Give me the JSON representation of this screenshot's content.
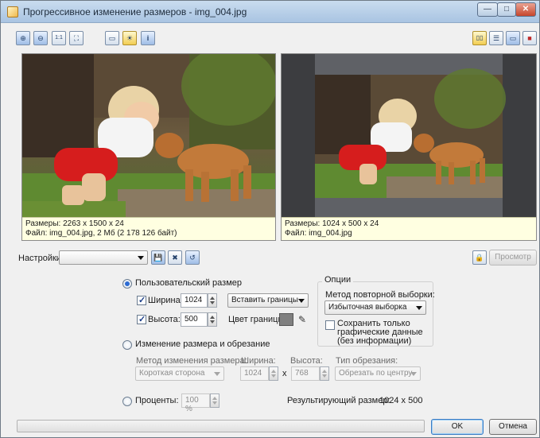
{
  "window": {
    "title": "Прогрессивное изменение размеров - img_004.jpg",
    "min_symbol": "—",
    "max_symbol": "□",
    "close_symbol": "✕"
  },
  "toolbar_left": [
    {
      "icon": "zoom-in-icon",
      "glyph": "⊕"
    },
    {
      "icon": "zoom-out-icon",
      "glyph": "⊖"
    },
    {
      "icon": "actual-size-icon",
      "glyph": "1:1"
    },
    {
      "icon": "fit-window-icon",
      "glyph": "⛶"
    },
    {
      "icon": "image-info-icon",
      "glyph": "▭"
    },
    {
      "icon": "sun-icon",
      "glyph": "☀"
    },
    {
      "icon": "info-icon",
      "glyph": "i"
    }
  ],
  "toolbar_right": [
    {
      "icon": "layout-side-by-side-icon",
      "glyph": "▯▯"
    },
    {
      "icon": "layout-stacked-icon",
      "glyph": "☰"
    },
    {
      "icon": "layout-single-icon",
      "glyph": "▭"
    },
    {
      "icon": "layout-full-icon",
      "glyph": "■"
    }
  ],
  "preview_original": {
    "size_line": "Размеры: 2263 x 1500 x 24",
    "file_line": "Файл: img_004.jpg, 2 Мб (2 178 126 байт)"
  },
  "preview_result": {
    "size_line": "Размеры: 1024 x 500 x 24",
    "file_line": "Файл: img_004.jpg"
  },
  "settings": {
    "label": "Настройки:",
    "value": "",
    "preview_button": "Просмотр"
  },
  "custom_size": {
    "label": "Пользовательский размер",
    "selected": true,
    "width_label": "Ширина:",
    "width_value": "1024",
    "width_checked": true,
    "height_label": "Высота:",
    "height_value": "500",
    "height_checked": true,
    "border_mode": "Вставить границы",
    "border_color_label": "Цвет границы:",
    "border_color": "#808080"
  },
  "options": {
    "title": "Опции",
    "resample_label": "Метод повторной выборки:",
    "resample_value": "Избыточная выборка",
    "save_graphics_label": "Сохранить только графические данные (без информации)",
    "save_graphics_checked": false
  },
  "resize_crop": {
    "label": "Изменение размера и обрезание",
    "selected": false,
    "method_label": "Метод изменения размера:",
    "method_value": "Короткая сторона",
    "width_label": "Ширина:",
    "width_value": "1024",
    "x_label": "x",
    "height_label": "Высота:",
    "height_value": "768",
    "crop_label": "Тип обрезания:",
    "crop_value": "Обрезать по центру"
  },
  "percent": {
    "label": "Проценты:",
    "selected": false,
    "value": "100 %"
  },
  "result": {
    "label": "Результирующий размер:",
    "value": "1024 x 500"
  },
  "progress": {
    "value": 0
  },
  "buttons": {
    "ok": "OK",
    "cancel": "Отмена"
  },
  "colors": {
    "accent": "#2c6bd3",
    "info_bg": "#ffffe1",
    "letterbox": "#5f6166"
  }
}
